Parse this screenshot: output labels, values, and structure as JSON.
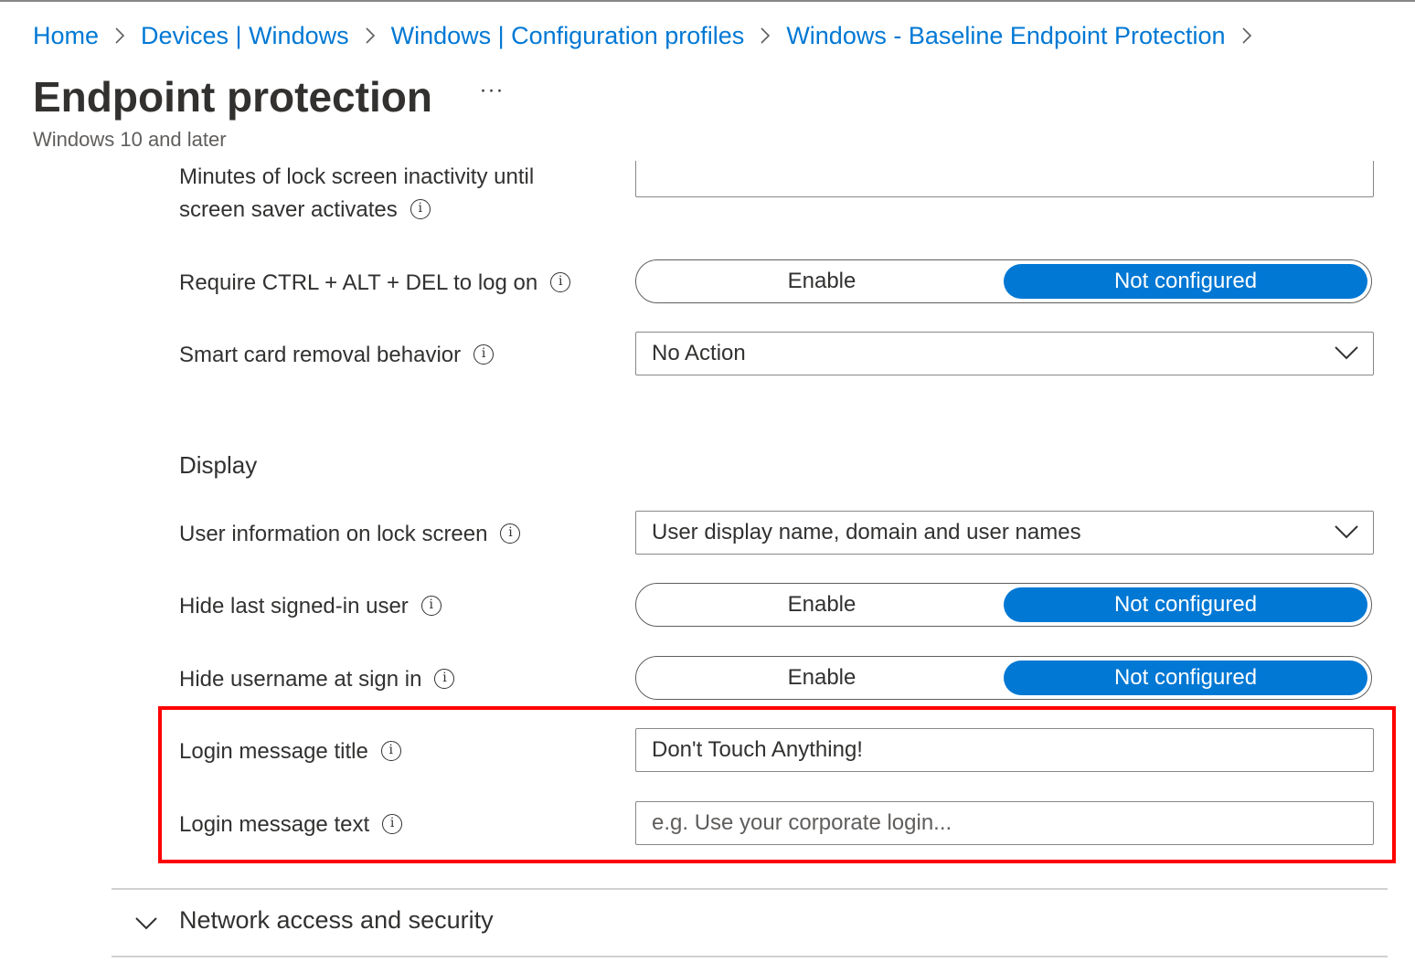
{
  "breadcrumb": {
    "items": [
      "Home",
      "Devices | Windows",
      "Windows | Configuration profiles",
      "Windows - Baseline Endpoint Protection"
    ]
  },
  "page": {
    "title": "Endpoint protection",
    "more_label": "···",
    "subtitle": "Windows 10 and later"
  },
  "settings": {
    "screen_saver": {
      "label_line1": "Minutes of lock screen inactivity until",
      "label_line2": "screen saver activates",
      "value": ""
    },
    "ctrl_alt_del": {
      "label": "Require CTRL + ALT + DEL to log on",
      "options": [
        "Enable",
        "Not configured"
      ],
      "selected": "Not configured"
    },
    "smart_card": {
      "label": "Smart card removal behavior",
      "value": "No Action"
    },
    "display_section": "Display",
    "user_info": {
      "label": "User information on lock screen",
      "value": "User display name, domain and user names"
    },
    "hide_last_user": {
      "label": "Hide last signed-in user",
      "options": [
        "Enable",
        "Not configured"
      ],
      "selected": "Not configured"
    },
    "hide_username": {
      "label": "Hide username at sign in",
      "options": [
        "Enable",
        "Not configured"
      ],
      "selected": "Not configured"
    },
    "login_title": {
      "label": "Login message title",
      "value": "Don't Touch Anything!"
    },
    "login_text": {
      "label": "Login message text",
      "value": "",
      "placeholder": "e.g. Use your corporate login..."
    }
  },
  "accordion": {
    "network": "Network access and security"
  },
  "colors": {
    "accent": "#0078d4",
    "highlight_box": "#ff0000"
  },
  "icons": [
    "chevron-right-icon",
    "info-icon",
    "chevron-down-icon"
  ]
}
